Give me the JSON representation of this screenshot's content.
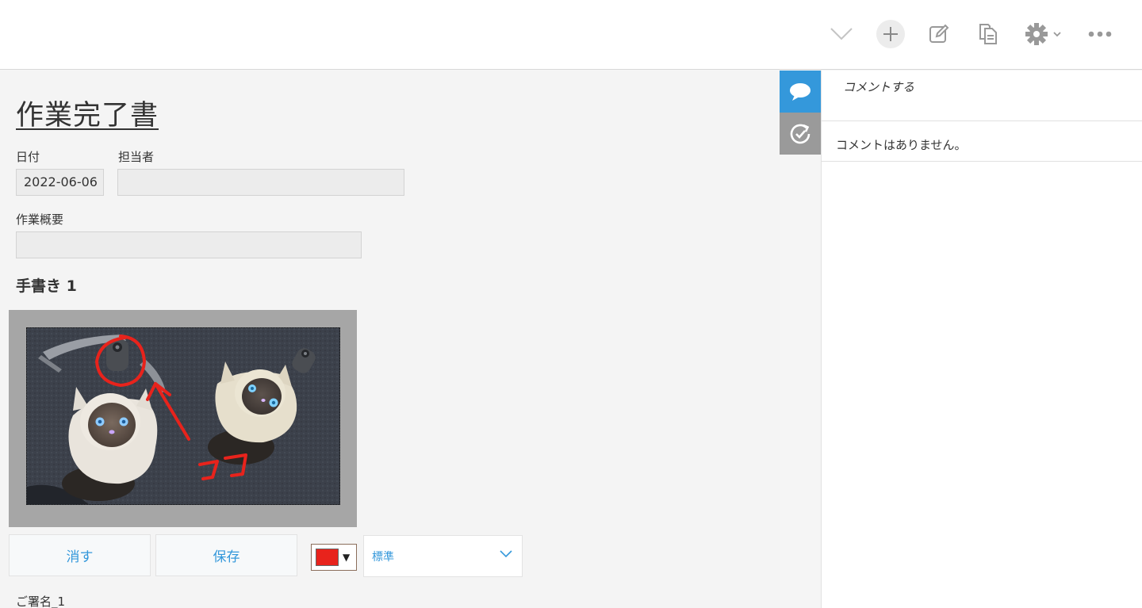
{
  "header": {
    "icons": [
      "chevron-down-icon",
      "plus-icon",
      "edit-icon",
      "duplicate-icon",
      "gear-icon",
      "more-icon"
    ]
  },
  "form": {
    "title": "作業完了書",
    "date_label": "日付",
    "date_value": "2022-06-06",
    "assignee_label": "担当者",
    "assignee_value": "",
    "summary_label": "作業概要",
    "summary_value": "",
    "handwriting_label": "手書き 1",
    "handwriting_annotation": "ココ",
    "erase_button": "消す",
    "save_button": "保存",
    "pen_color": "#e8231c",
    "pen_width_selected": "標準",
    "signature_label": "ご署名_1"
  },
  "side_tabs": {
    "comment_tab": "comment-icon",
    "history_tab": "history-icon"
  },
  "comments": {
    "placeholder": "コメントする",
    "empty_message": "コメントはありません。"
  },
  "colors": {
    "accent": "#3498db",
    "history_tab": "#9a9a9a",
    "annotation_red": "#e8231c"
  }
}
